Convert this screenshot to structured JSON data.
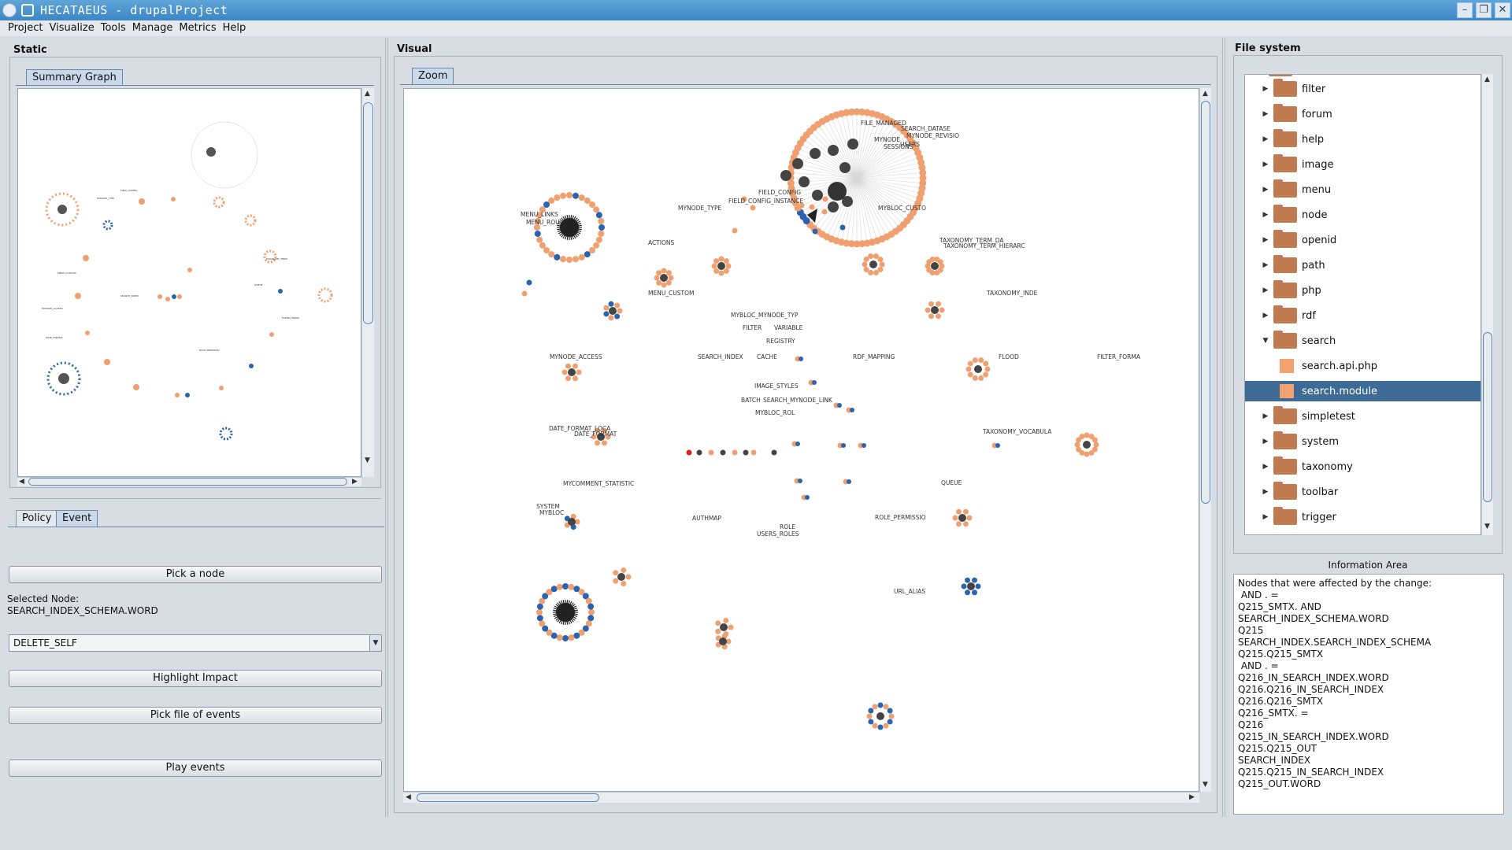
{
  "window": {
    "title": "HECATAEUS - drupalProject",
    "min_icon": "minimize-icon",
    "max_icon": "maximize-icon",
    "close_icon": "close-icon"
  },
  "menu": [
    "Project",
    "Visualize",
    "Tools",
    "Manage",
    "Metrics",
    "Help"
  ],
  "static_panel": {
    "title": "Static",
    "tab": "Summary Graph",
    "bottom_tabs": [
      "Policy",
      "Event"
    ],
    "active_bottom_tab": "Event",
    "pick_node_label": "Pick a node",
    "selected_node_label": "Selected Node:",
    "selected_node_value": "SEARCH_INDEX_SCHEMA.WORD",
    "event_select_value": "DELETE_SELF",
    "highlight_label": "Highlight Impact",
    "pick_file_label": "Pick file of events",
    "play_label": "Play events"
  },
  "visual_panel": {
    "title": "Visual",
    "tab": "Zoom",
    "graph_labels": [
      "MENU_LINKS",
      "MENU_ROU",
      "MYNODE_TYPE",
      "FIELD_CONFIG",
      "FIELD_CONFIG_INSTANCE",
      "MYBLOC_CUSTO",
      "ACTIONS",
      "TAXONOMY_TERM_DA",
      "TAXONOMY_TERM_HIERARC",
      "MENU_CUSTOM",
      "TAXONOMY_INDE",
      "MYBLOC_MYNODE_TYP",
      "FILTER",
      "VARIABLE",
      "REGISTRY",
      "MYNODE_ACCESS",
      "SEARCH_INDEX",
      "CACHE",
      "RDF_MAPPING",
      "FLOOD",
      "FILTER_FORMA",
      "IMAGE_STYLES",
      "BATCH",
      "SEARCH_MYNODE_LINK",
      "MYBLOC_ROL",
      "DATE_FORMAT_LOCA",
      "DATE_FORMAT",
      "TAXONOMY_VOCABULA",
      "MYCOMMENT_STATISTIC",
      "SYSTEM",
      "MYBLOC",
      "QUEUE",
      "AUTHMAP",
      "ROLE_PERMISSIO",
      "ROLE",
      "USERS_ROLES",
      "URL_ALIAS",
      "FILE_MANAGED",
      "SEARCH_DATASE",
      "MYNODE_REVISIO",
      "MYNODE",
      "SESSIONS",
      "USERS"
    ]
  },
  "fs_panel": {
    "title": "File system",
    "items": [
      {
        "label": "filter",
        "kind": "folder",
        "expanded": false
      },
      {
        "label": "forum",
        "kind": "folder",
        "expanded": false
      },
      {
        "label": "help",
        "kind": "folder",
        "expanded": false
      },
      {
        "label": "image",
        "kind": "folder",
        "expanded": false
      },
      {
        "label": "menu",
        "kind": "folder",
        "expanded": false
      },
      {
        "label": "node",
        "kind": "folder",
        "expanded": false
      },
      {
        "label": "openid",
        "kind": "folder",
        "expanded": false
      },
      {
        "label": "path",
        "kind": "folder",
        "expanded": false
      },
      {
        "label": "php",
        "kind": "folder",
        "expanded": false
      },
      {
        "label": "rdf",
        "kind": "folder",
        "expanded": false
      },
      {
        "label": "search",
        "kind": "folder",
        "expanded": true
      },
      {
        "label": "search.api.php",
        "kind": "file"
      },
      {
        "label": "search.module",
        "kind": "file",
        "selected": true
      },
      {
        "label": "simpletest",
        "kind": "folder",
        "expanded": false
      },
      {
        "label": "system",
        "kind": "folder",
        "expanded": false
      },
      {
        "label": "taxonomy",
        "kind": "folder",
        "expanded": false
      },
      {
        "label": "toolbar",
        "kind": "folder",
        "expanded": false
      },
      {
        "label": "trigger",
        "kind": "folder",
        "expanded": false
      }
    ]
  },
  "info_area": {
    "title": "Information Area",
    "text": "Nodes that were affected by the change:\n AND . =\nQ215_SMTX. AND\nSEARCH_INDEX_SCHEMA.WORD\nQ215\nSEARCH_INDEX.SEARCH_INDEX_SCHEMA\nQ215.Q215_SMTX\n AND . =\nQ216_IN_SEARCH_INDEX.WORD\nQ216.Q216_IN_SEARCH_INDEX\nQ216.Q216_SMTX\nQ216_SMTX. =\nQ216\nQ215_IN_SEARCH_INDEX.WORD\nQ215.Q215_OUT\nSEARCH_INDEX\nQ215.Q215_IN_SEARCH_INDEX\nQ215_OUT.WORD"
  },
  "colors": {
    "title_bar": "#3b86c4",
    "node_orange": "#f0a070",
    "node_blue": "#2a64b0",
    "node_dark": "#555555",
    "selection": "#3e6b96",
    "folder": "#c07a4f"
  }
}
